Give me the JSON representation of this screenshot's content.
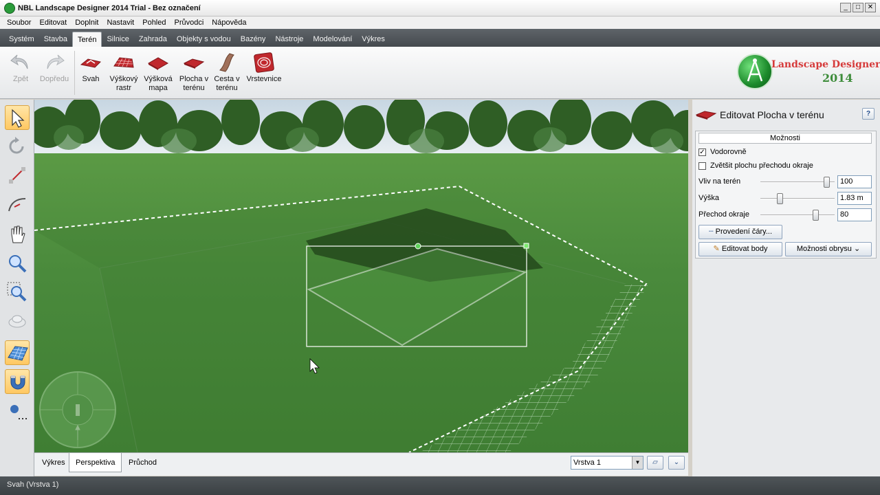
{
  "window": {
    "title": "NBL Landscape Designer 2014 Trial - Bez označení",
    "buttons": [
      "_",
      "□",
      "✕"
    ]
  },
  "menu": [
    "Soubor",
    "Editovat",
    "Doplnit",
    "Nastavit",
    "Pohled",
    "Průvodci",
    "Nápověda"
  ],
  "ribbon_tabs": [
    "Systém",
    "Stavba",
    "Terén",
    "Silnice",
    "Zahrada",
    "Objekty s vodou",
    "Bazény",
    "Nástroje",
    "Modelování",
    "Výkres"
  ],
  "active_tab": "Terén",
  "ribbon": {
    "back": "Zpět",
    "forward": "Dopředu",
    "slope": "Svah",
    "height_grid": "Výškový rastr",
    "height_map": "Výšková mapa",
    "terrain_area": "Plocha v terénu",
    "terrain_path": "Cesta v terénu",
    "contours": "Vrstevnice"
  },
  "logo": {
    "line1": "Landscape Designer",
    "line2": "2014"
  },
  "left_tools": [
    "select-arrow-icon",
    "rotate-icon",
    "draw-line-icon",
    "arc-icon",
    "hand-pan-icon",
    "zoom-icon",
    "zoom-window-icon",
    "cloud-icon",
    "grid-icon",
    "magnet-icon",
    "measure-icon"
  ],
  "bottom_tabs": [
    "Výkres",
    "Perspektiva",
    "Průchod"
  ],
  "active_bottom_tab": "Perspektiva",
  "layer": "Vrstva 1",
  "panel": {
    "title": "Editovat Plocha v terénu",
    "help": "?",
    "options_header": "Možnosti",
    "horizontal_label": "Vodorovně",
    "horizontal_checked": true,
    "enlarge_label": "Zvětšit plochu přechodu okraje",
    "enlarge_checked": false,
    "influence_label": "Vliv na terén",
    "influence_value": "100",
    "influence_level": 0.85,
    "height_label": "Výška",
    "height_value": "1.83 m",
    "height_level": 0.22,
    "edge_label": "Přechod okraje",
    "edge_value": "80",
    "edge_level": 0.7,
    "line_btn": "Provedení čáry...",
    "edit_points_btn": "Editovat body",
    "outline_btn": "Možnosti obrysu"
  },
  "status": "Svah (Vrstva 1)",
  "colors": {
    "grass": "#4a8a3c",
    "ribbon_dark": "#4a4f53",
    "accent_red": "#c0282d"
  }
}
